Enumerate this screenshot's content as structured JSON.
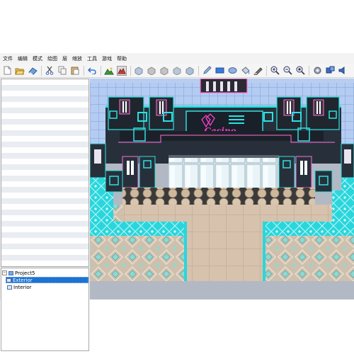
{
  "menu": [
    "文件",
    "编辑",
    "模式",
    "绘图",
    "层",
    "缩放",
    "工具",
    "游戏",
    "帮助"
  ],
  "toolbar": {
    "icons": [
      "new-project-icon",
      "open-project-icon",
      "save-project-icon",
      "cut-icon",
      "copy-icon",
      "paste-icon",
      "undo-icon",
      "map-layer-icon",
      "event-layer-icon",
      "region-a-icon",
      "region-b-icon",
      "region-c-icon",
      "region-d-icon",
      "region-e-icon",
      "pencil-icon",
      "rectangle-icon",
      "ellipse-icon",
      "fill-icon",
      "shadow-pen-icon",
      "zoom-in-icon",
      "zoom-out-icon",
      "zoom-actual-icon",
      "database-icon",
      "plugin-icon",
      "sound-test-icon"
    ]
  },
  "tree": {
    "root": "Project5",
    "maps": [
      {
        "label": "Exterior",
        "selected": true
      },
      {
        "label": "Interior",
        "selected": false
      }
    ]
  },
  "map": {
    "sign_text": "Casino",
    "colors": {
      "accent": "#2ee0e0",
      "neon_pink": "#ff3fc8",
      "selection": "#1e72d2"
    }
  }
}
